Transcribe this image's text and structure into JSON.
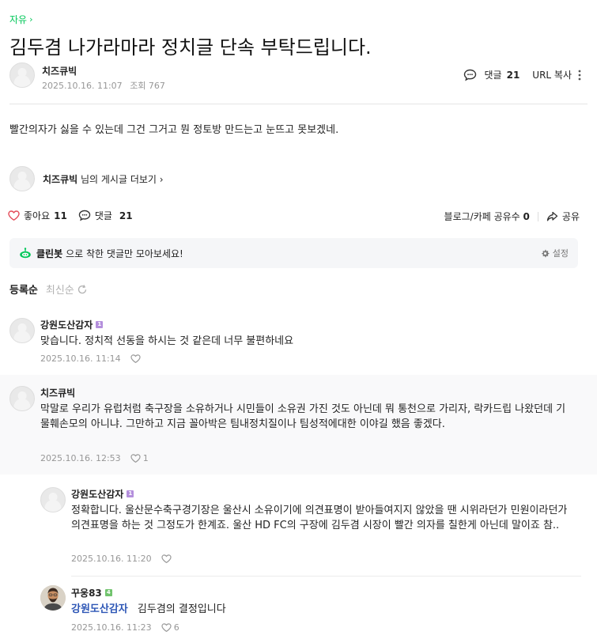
{
  "breadcrumb": {
    "board_name": "자유",
    "chevron": "›"
  },
  "post": {
    "title": "김두겸 나가라마라 정치글 단속 부탁드립니다.",
    "author": "치즈큐빅",
    "date": "2025.10.16. 11:07",
    "views_label": "조회 767",
    "body": "빨간의자가 싫을 수 있는데 그건 그거고 뭔 정토방 만드는고 눈뜨고 못보겠네."
  },
  "topbar": {
    "comment_label": "댓글",
    "comment_count": "21",
    "url_copy_label": "URL 복사"
  },
  "profile_more": {
    "author": "치즈큐빅",
    "suffix": "님의 게시글 더보기"
  },
  "actions": {
    "like_label": "좋아요",
    "like_count": "11",
    "comment_label": "댓글",
    "comment_count": "21",
    "blog_share_label": "블로그/카페 공유수",
    "blog_share_count": "0",
    "share_label": "공유"
  },
  "cleanbot": {
    "name": "클린봇",
    "text": "으로 착한 댓글만 모아보세요!",
    "settings_label": "설정"
  },
  "sort": {
    "by_registered": "등록순",
    "by_latest": "최신순"
  },
  "comments": [
    {
      "author": "강원도산감자",
      "badge": "1",
      "text": "맞습니다. 정치적 선동을 하시는 것 같은데 너무 불편하네요",
      "date": "2025.10.16. 11:14",
      "likes": ""
    },
    {
      "author": "치즈큐빅",
      "badge": "",
      "text": "막말로 우리가 유럽처럼 축구장을 소유하거나 시민들이 소유권 가진 것도 아닌데 뭐 통천으로 가리자, 락카드립 나왔던데 기물훼손모의 아니냐. 그만하고 지금 꼴아박은 팀내정치질이나 팀성적에대한 이야길 했음 좋겠다.",
      "date": "2025.10.16. 12:53",
      "likes": "1"
    },
    {
      "author": "강원도산감자",
      "badge": "1",
      "text": "정확합니다. 울산문수축구경기장은 울산시 소유이기에 의견표명이 받아들여지지 않았을 땐 시위라던가 민원이라던가 의견표명을 하는 것 그정도가 한계죠. 울산 HD FC의 구장에 김두겸 시장이 빨간 의자를 칠한게 아닌데 말이죠 참..",
      "date": "2025.10.16. 11:20",
      "likes": ""
    },
    {
      "author": "꾸웅83",
      "badge": "4",
      "mention": "강원도산감자",
      "text": "김두겸의 결정입니다",
      "date": "2025.10.16. 11:23",
      "likes": "6"
    }
  ]
}
